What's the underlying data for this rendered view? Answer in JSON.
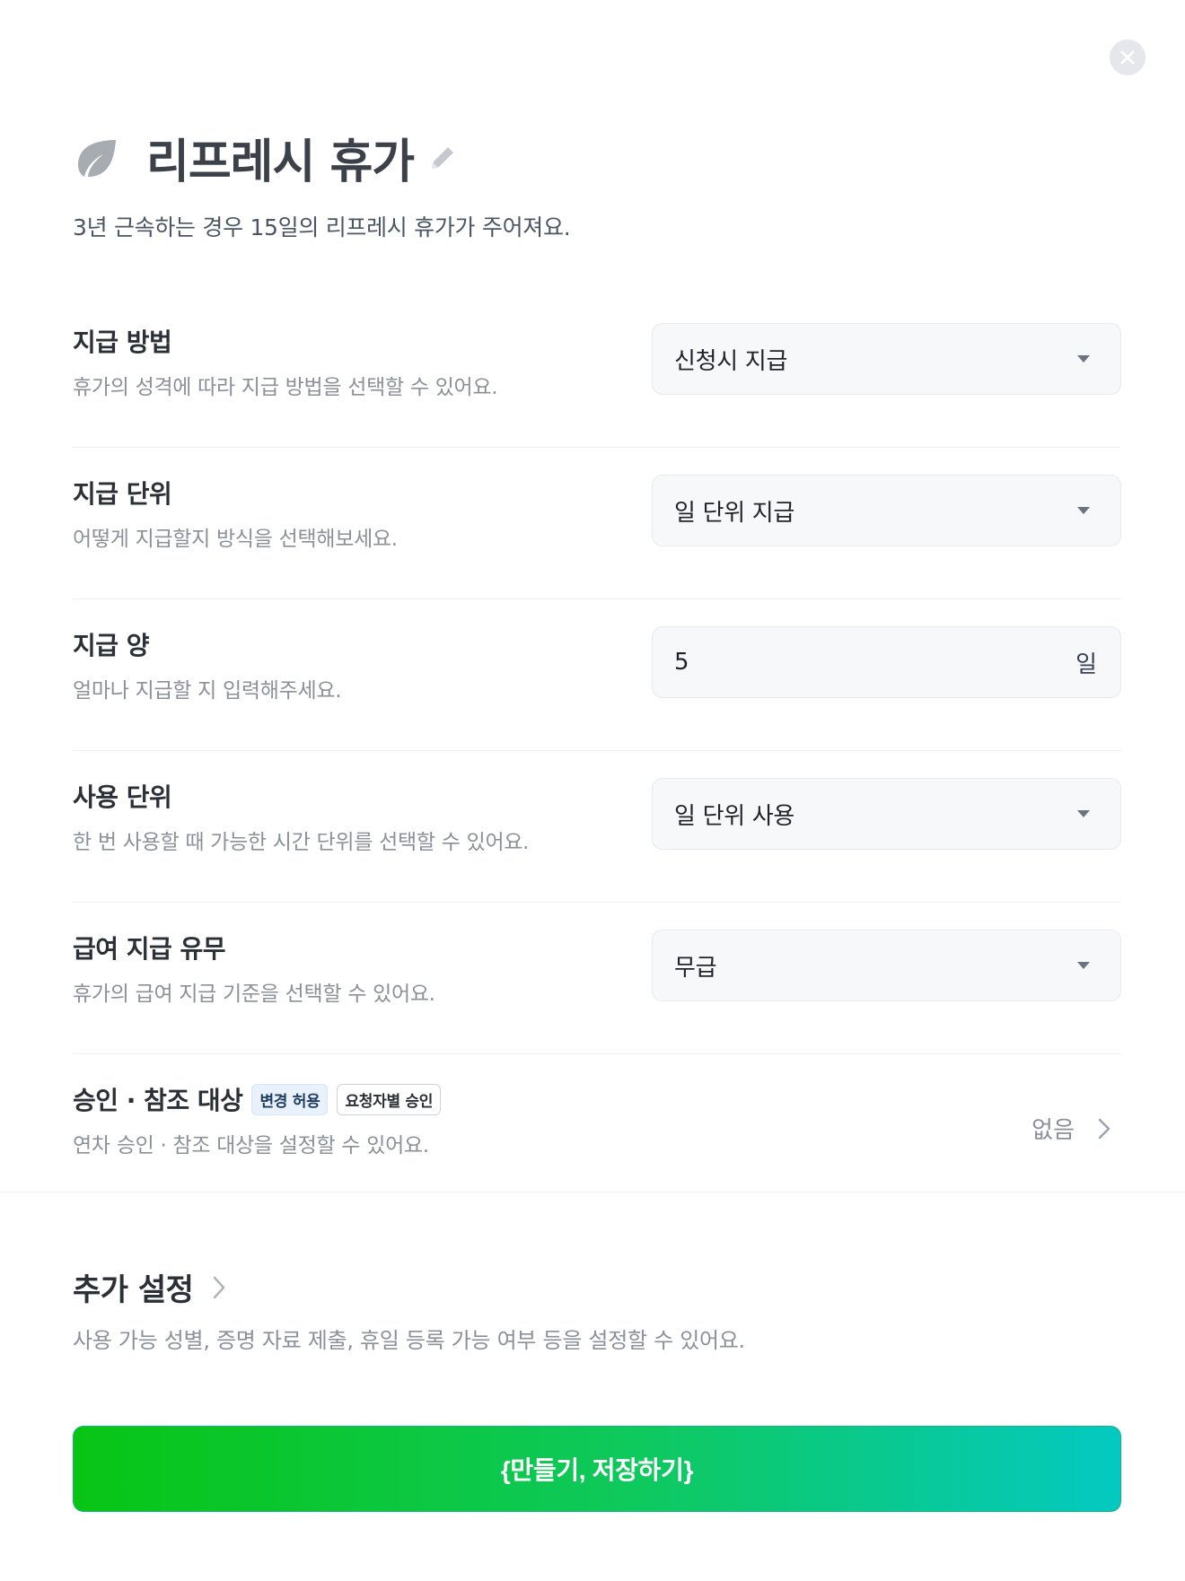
{
  "header": {
    "title": "리프레시 휴가",
    "description": "3년 근속하는 경우 15일의 리프레시 휴가가 주어져요."
  },
  "settings": [
    {
      "label": "지급 방법",
      "sub": "휴가의 성격에 따라 지급 방법을 선택할 수 있어요.",
      "value": "신청시 지급"
    },
    {
      "label": "지급 단위",
      "sub": "어떻게 지급할지 방식을 선택해보세요.",
      "value": "일 단위 지급"
    },
    {
      "label": "지급 양",
      "sub": "얼마나 지급할 지 입력해주세요.",
      "value": "5",
      "unit": "일"
    },
    {
      "label": "사용 단위",
      "sub": "한 번 사용할 때 가능한 시간 단위를 선택할 수 있어요.",
      "value": "일 단위 사용"
    },
    {
      "label": "급여 지급 유무",
      "sub": "휴가의 급여 지급 기준을 선택할 수 있어요.",
      "value": "무급"
    }
  ],
  "approval": {
    "label": "승인 · 참조 대상",
    "tags": [
      "변경 허용",
      "요청자별 승인"
    ],
    "sub": "연차 승인 · 참조 대상을 설정할 수 있어요.",
    "value": "없음"
  },
  "extra": {
    "title": "추가 설정",
    "description": "사용 가능 성별, 증명 자료 제출, 휴일 등록 가능 여부 등을 설정할 수 있어요."
  },
  "submit_label": "{만들기, 저장하기}",
  "colors": {
    "gradient_start": "#08c514",
    "gradient_end": "#04c9c2",
    "leaf_icon": "#a7abb2"
  },
  "icons": [
    "close-icon",
    "leaf-icon",
    "pencil-icon",
    "caret-down-icon",
    "chevron-right-icon"
  ]
}
